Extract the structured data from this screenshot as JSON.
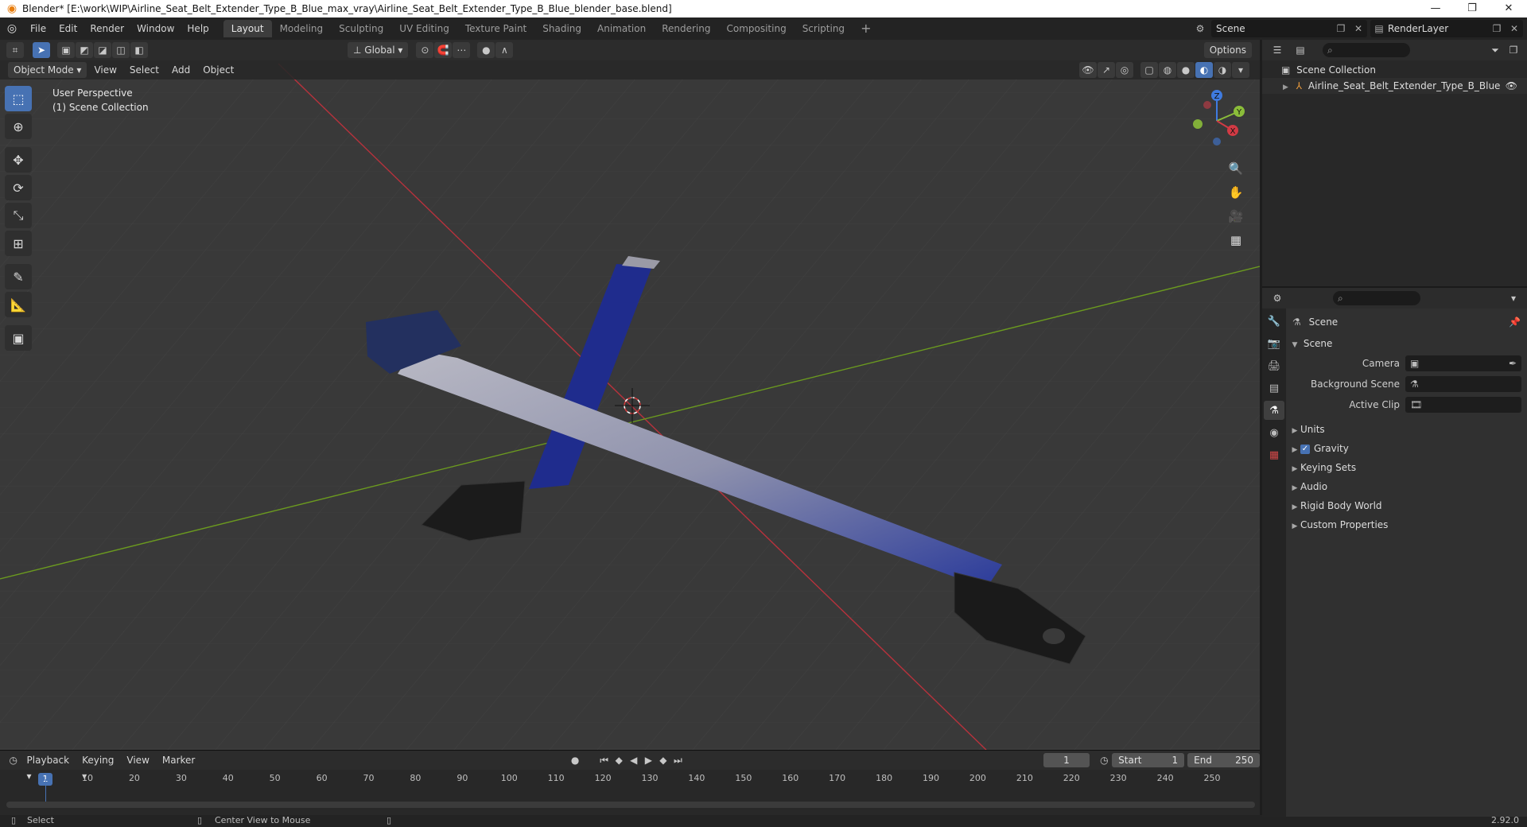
{
  "window": {
    "title": "Blender* [E:\\work\\WIP\\Airline_Seat_Belt_Extender_Type_B_Blue_max_vray\\Airline_Seat_Belt_Extender_Type_B_Blue_blender_base.blend]",
    "controls": [
      "—",
      "❐",
      "✕"
    ]
  },
  "menu": [
    "File",
    "Edit",
    "Render",
    "Window",
    "Help"
  ],
  "workspaces": [
    "Layout",
    "Modeling",
    "Sculpting",
    "UV Editing",
    "Texture Paint",
    "Shading",
    "Animation",
    "Rendering",
    "Compositing",
    "Scripting"
  ],
  "add_workspace": "+",
  "scene_selector": "Scene",
  "render_layer": "RenderLayer",
  "viewport": {
    "mode": "Object Mode",
    "menus": [
      "View",
      "Select",
      "Add",
      "Object"
    ],
    "orientation": "Global",
    "options": "Options",
    "overlay_line1": "User Perspective",
    "overlay_line2": "(1) Scene Collection"
  },
  "gizmo": {
    "x": "X",
    "y": "Y",
    "z": "Z"
  },
  "timeline": {
    "menus": [
      "Playback",
      "Keying",
      "View",
      "Marker"
    ],
    "current_frame": "1",
    "start_label": "Start",
    "start": "1",
    "end_label": "End",
    "end": "250",
    "ticks": [
      "1",
      "10",
      "20",
      "30",
      "40",
      "50",
      "60",
      "70",
      "80",
      "90",
      "100",
      "110",
      "120",
      "130",
      "140",
      "150",
      "160",
      "170",
      "180",
      "190",
      "200",
      "210",
      "220",
      "230",
      "240",
      "250"
    ]
  },
  "statusbar": {
    "select": "Select",
    "center_view": "Center View to Mouse",
    "version": "2.92.0"
  },
  "outliner": {
    "root": "Scene Collection",
    "object": "Airline_Seat_Belt_Extender_Type_B_Blue"
  },
  "properties": {
    "context": "Scene",
    "panel_title": "Scene",
    "camera_label": "Camera",
    "background_label": "Background Scene",
    "clip_label": "Active Clip",
    "panels": [
      "Units",
      "Gravity",
      "Keying Sets",
      "Audio",
      "Rigid Body World",
      "Custom Properties"
    ],
    "gravity_checked": true
  },
  "colors": {
    "accent": "#4772b3",
    "axis_x": "#b8323c",
    "axis_y": "#6b9a1f",
    "belt": "#1e2c8c"
  }
}
